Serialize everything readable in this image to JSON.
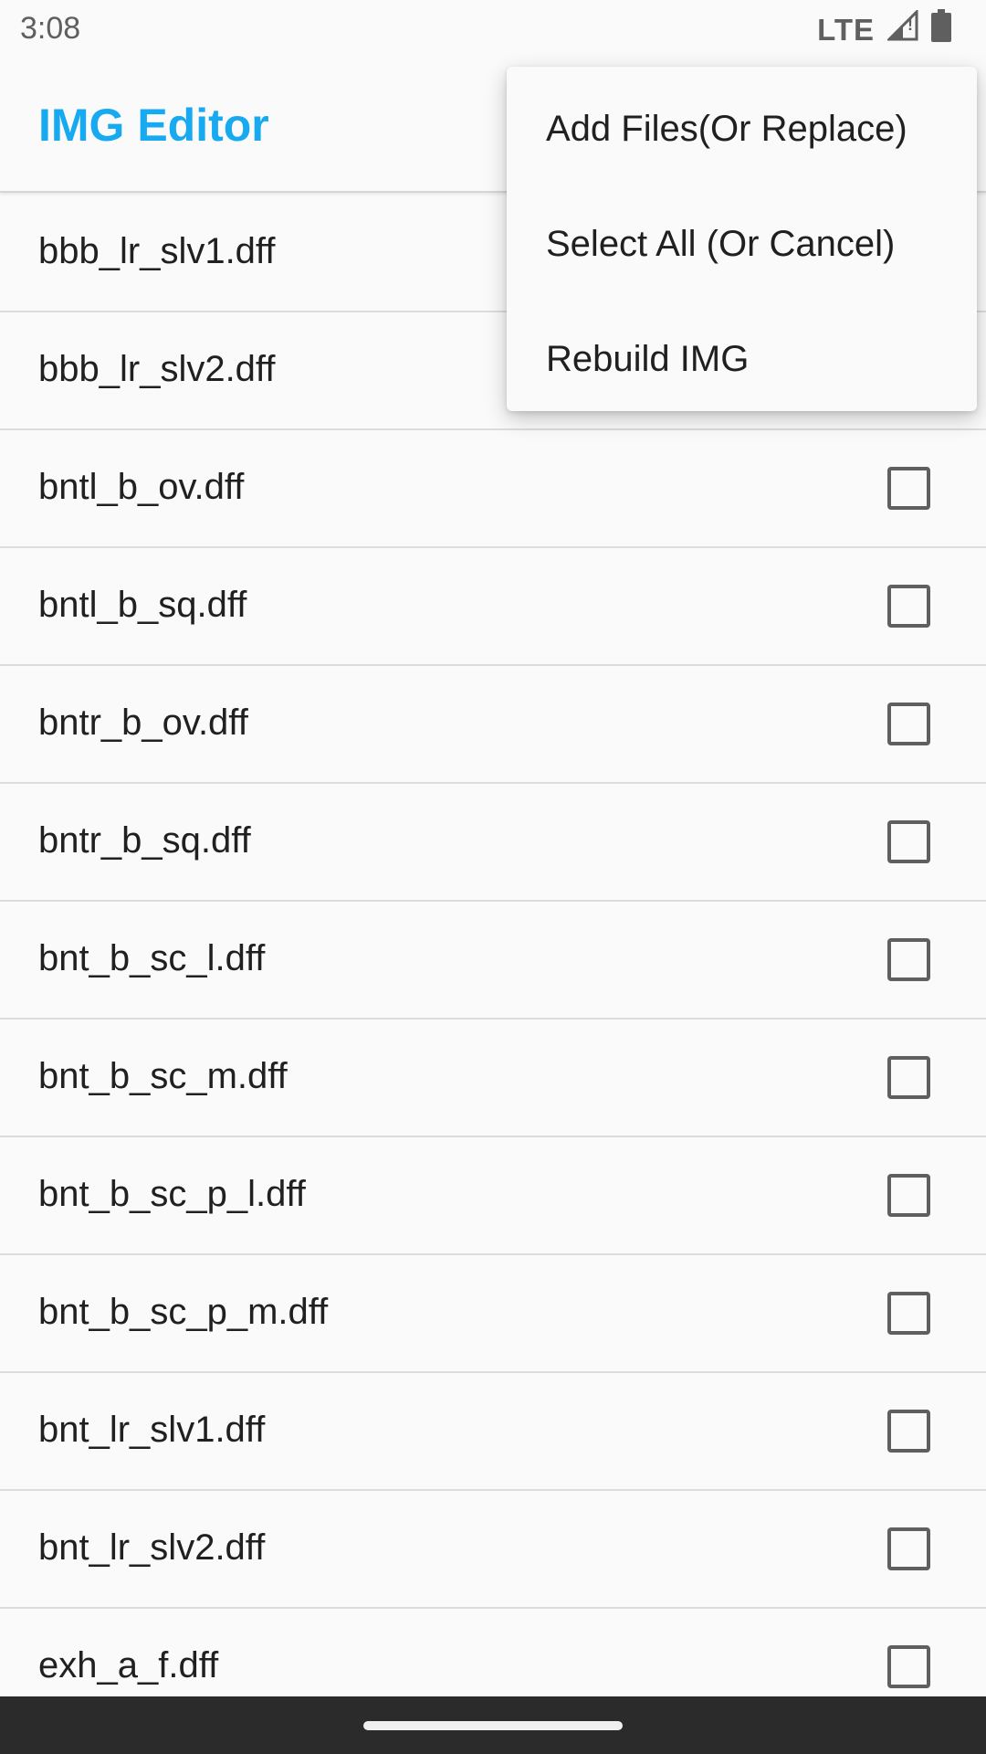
{
  "status_bar": {
    "time": "3:08",
    "network": "LTE",
    "icons": [
      "signal-icon",
      "battery-icon"
    ]
  },
  "app_bar": {
    "title": "IMG Editor",
    "title_color": "#17aaf0"
  },
  "files": [
    {
      "name": "bbb_lr_slv1.dff",
      "checked": false
    },
    {
      "name": "bbb_lr_slv2.dff",
      "checked": false
    },
    {
      "name": "bntl_b_ov.dff",
      "checked": false
    },
    {
      "name": "bntl_b_sq.dff",
      "checked": false
    },
    {
      "name": "bntr_b_ov.dff",
      "checked": false
    },
    {
      "name": "bntr_b_sq.dff",
      "checked": false
    },
    {
      "name": "bnt_b_sc_l.dff",
      "checked": false
    },
    {
      "name": "bnt_b_sc_m.dff",
      "checked": false
    },
    {
      "name": "bnt_b_sc_p_l.dff",
      "checked": false
    },
    {
      "name": "bnt_b_sc_p_m.dff",
      "checked": false
    },
    {
      "name": "bnt_lr_slv1.dff",
      "checked": false
    },
    {
      "name": "bnt_lr_slv2.dff",
      "checked": false
    },
    {
      "name": "exh_a_f.dff",
      "checked": false
    }
  ],
  "menu": {
    "items": [
      {
        "label": "Add Files(Or Replace)"
      },
      {
        "label": "Select All (Or Cancel)"
      },
      {
        "label": "Rebuild IMG"
      }
    ]
  }
}
